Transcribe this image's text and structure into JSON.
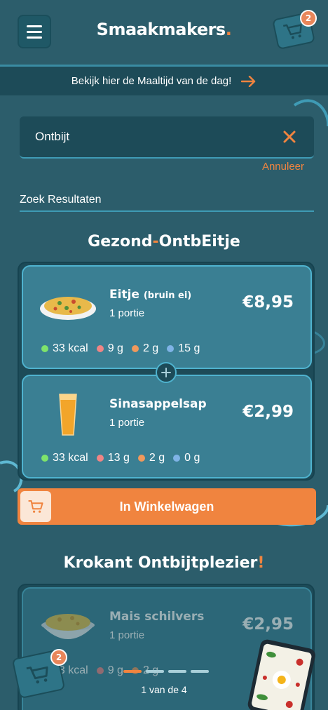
{
  "app": {
    "name": "Smaakmakers",
    "logo_dot": "."
  },
  "header": {
    "cart_count": "2"
  },
  "banner": {
    "text": "Bekijk hier de Maaltijd van de dag!"
  },
  "search": {
    "value": "Ontbijt",
    "cancel_label": "Annuleer"
  },
  "results": {
    "label": "Zoek Resultaten"
  },
  "menus": [
    {
      "title_part1": "Gezond",
      "title_dash": "-",
      "title_part2": "OntbEitje",
      "items": [
        {
          "name": "Eitje",
          "name_sub": "(bruin ei)",
          "portion": "1 portie",
          "price": "€8,95",
          "kcal": "33 kcal",
          "n2": "9 g",
          "n3": "2 g",
          "n4": "15 g"
        },
        {
          "name": "Sinasappelsap",
          "portion": "1 portie",
          "price": "€2,99",
          "kcal": "33 kcal",
          "n2": "13 g",
          "n3": "2 g",
          "n4": "0 g"
        }
      ],
      "add_label": "In Winkelwagen"
    },
    {
      "title": "Krokant Ontbijtplezier",
      "title_mark": "!",
      "items": [
        {
          "name": "Mais schilvers",
          "portion": "1 portie",
          "price": "€2,95",
          "kcal": "33 kcal",
          "n2": "9 g",
          "n3": "2 g"
        }
      ]
    }
  ],
  "float_cart": {
    "count": "2"
  },
  "pagination": {
    "text": "1 van de 4",
    "current": 1,
    "total": 4
  },
  "colors": {
    "background": "#2c5d6b",
    "accent": "#f0843f",
    "card": "#3a7f93",
    "kcal_dot": "#7ee36b",
    "dot2": "#f08585",
    "dot3": "#f0995c",
    "dot4": "#7fb3e6"
  },
  "icons": [
    "menu-icon",
    "cart-icon",
    "arrow-right-icon",
    "close-icon",
    "plus-icon",
    "omelette-image",
    "orange-juice-image",
    "cornflakes-image",
    "phone-illustration"
  ]
}
